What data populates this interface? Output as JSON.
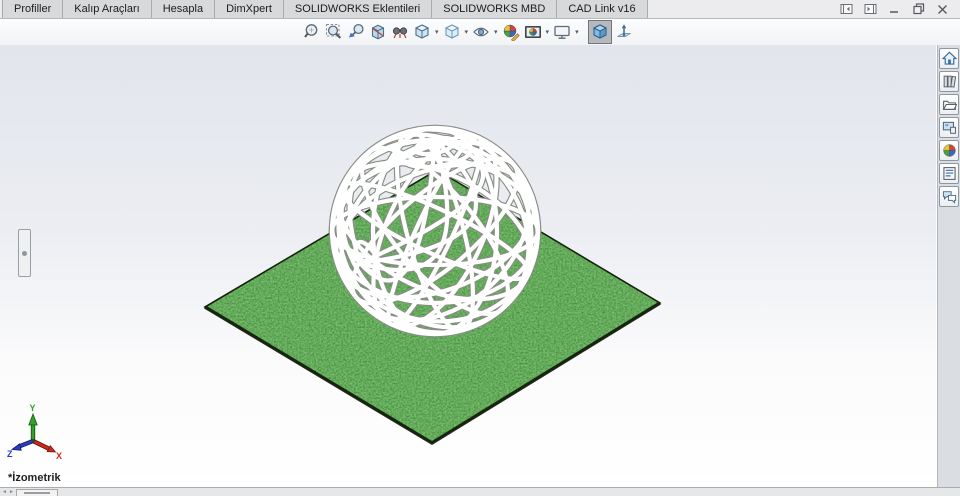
{
  "tab_bar": {
    "tabs": [
      {
        "label": "Profiller"
      },
      {
        "label": "Kalıp Araçları"
      },
      {
        "label": "Hesapla"
      },
      {
        "label": "DimXpert"
      },
      {
        "label": "SOLIDWORKS Eklentileri"
      },
      {
        "label": "SOLIDWORKS MBD"
      },
      {
        "label": "CAD Link v16"
      }
    ]
  },
  "window_controls": {
    "items": [
      "toggle-pane-left",
      "toggle-pane-right",
      "minimize",
      "restore-down",
      "close"
    ]
  },
  "toolbar": {
    "icons": [
      "zoom-to-fit",
      "zoom-to-area",
      "previous-view",
      "section-view",
      "dynamic-annotation-views",
      "view-orientation",
      "display-style",
      "hide-show-items",
      "edit-appearance",
      "apply-scene",
      "view-settings",
      "3d-drawing-view",
      "normal-to"
    ],
    "caret": "▾"
  },
  "task_pane": {
    "items": [
      "solidworks-resources",
      "design-library",
      "file-explorer",
      "view-palette",
      "appearances-scenes",
      "custom-properties",
      "solidworks-forum"
    ]
  },
  "viewport": {
    "view_label": "*İzometrik",
    "triad": {
      "x_label": "X",
      "y_label": "Y",
      "z_label": "Z"
    },
    "colors": {
      "grass": "#33632b",
      "grass_edge": "#16230e",
      "wire": "#ffffff",
      "wire_edge": "#888e85",
      "bg_top": "#e2e5ec",
      "bg_bottom": "#ffffff",
      "axis_x": "#cc2a1f",
      "axis_y": "#2fa327",
      "axis_z": "#2b3bc4"
    }
  },
  "status_bar": {
    "prev_icon": "◄",
    "next_icon": "►"
  }
}
